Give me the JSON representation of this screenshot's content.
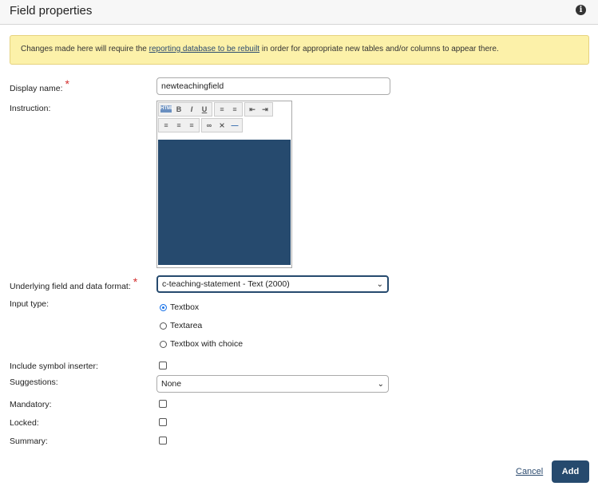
{
  "header": {
    "title": "Field properties",
    "info_icon": "info-icon"
  },
  "alert": {
    "text_before": "Changes made here will require the ",
    "link": "reporting database to be rebuilt",
    "text_after": " in order for appropriate new tables and/or columns to appear there."
  },
  "fields": {
    "display_name": {
      "label": "Display name:",
      "value": "newteachingfield"
    },
    "instruction": {
      "label": "Instruction:"
    },
    "underlying": {
      "label": "Underlying field and data format:",
      "value": "c-teaching-statement - Text (2000)"
    },
    "input_type": {
      "label": "Input type:",
      "options": [
        "Textbox",
        "Textarea",
        "Textbox with choice"
      ],
      "selected": "Textbox"
    },
    "symbol": {
      "label": "Include symbol inserter:",
      "checked": false
    },
    "suggestions": {
      "label": "Suggestions:",
      "value": "None"
    },
    "mandatory": {
      "label": "Mandatory:",
      "checked": false
    },
    "locked": {
      "label": "Locked:",
      "checked": false
    },
    "summary": {
      "label": "Summary:",
      "checked": false
    }
  },
  "toolbar": {
    "html": "HTML",
    "bold": "B",
    "italic": "I",
    "underline": "U",
    "ol": "≡",
    "ul": "≡",
    "outdent": "⇤",
    "indent": "⇥",
    "left": "≡",
    "center": "≡",
    "right": "≡",
    "link": "∞",
    "unlink": "⨯",
    "hr": "—"
  },
  "actions": {
    "cancel": "Cancel",
    "add": "Add"
  },
  "colors": {
    "accent": "#264a6e",
    "alert_bg": "#fcf1a9",
    "required": "#d32f2f"
  }
}
